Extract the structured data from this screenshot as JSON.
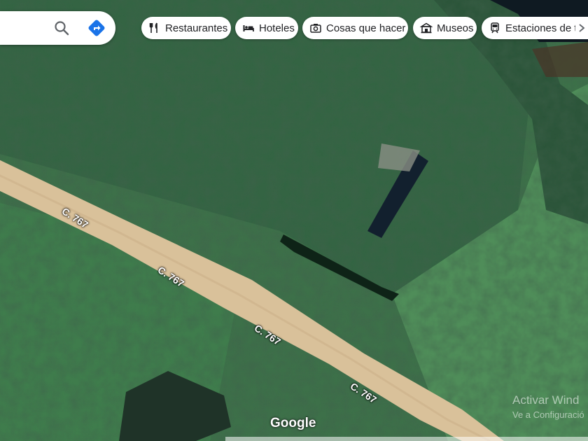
{
  "search": {
    "search_icon": "search-icon",
    "directions_icon": "directions-icon"
  },
  "chips": [
    {
      "label": "Restaurantes",
      "icon": "fork-knife-icon"
    },
    {
      "label": "Hoteles",
      "icon": "bed-icon"
    },
    {
      "label": "Cosas que hacer",
      "icon": "camera-icon"
    },
    {
      "label": "Museos",
      "icon": "museum-icon"
    },
    {
      "label": "Estaciones de tr",
      "icon": "train-icon"
    }
  ],
  "chip_scroll_icon": "chevron-right-icon",
  "road_labels": [
    "C. 767",
    "C. 767",
    "C. 767",
    "C. 767"
  ],
  "brand": "Google",
  "watermark": {
    "line1": "Activar Wind",
    "line2": "Ve a Configuració"
  },
  "colors": {
    "road": "#d9c19a",
    "vegetation": "#3f7a4e",
    "brand_blue": "#1a73e8"
  }
}
